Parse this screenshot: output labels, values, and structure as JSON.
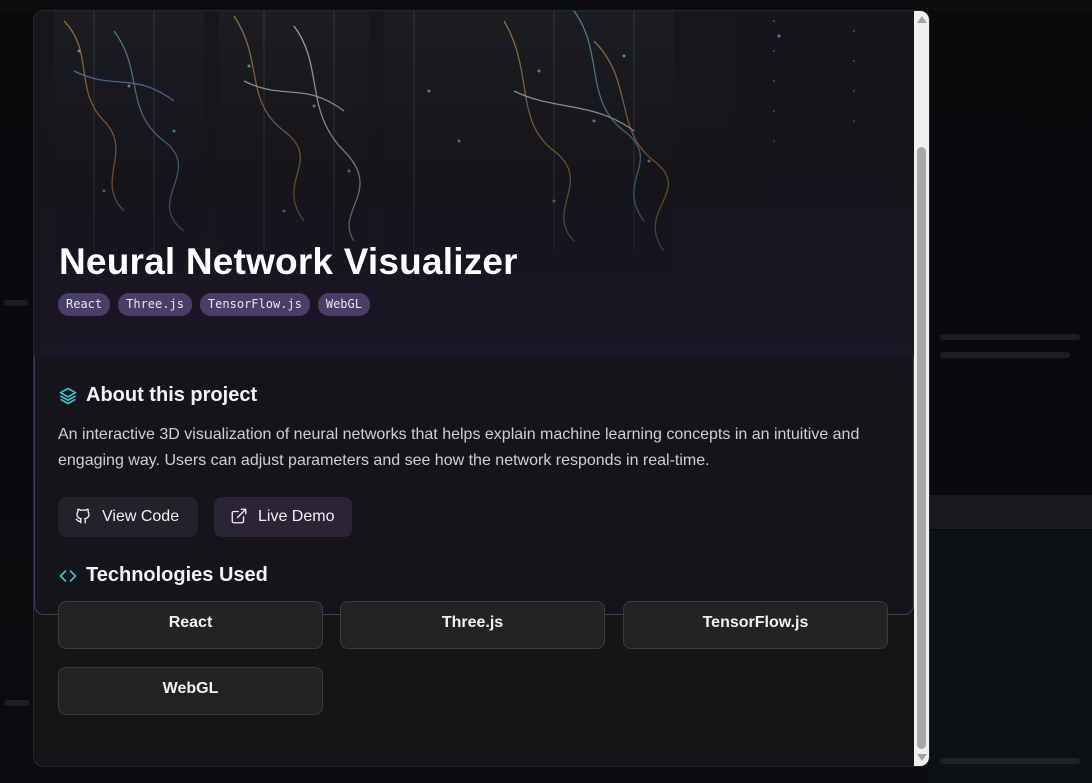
{
  "project": {
    "title": "Neural Network Visualizer",
    "tags": [
      "React",
      "Three.js",
      "TensorFlow.js",
      "WebGL"
    ],
    "about_heading": "About this project",
    "description": "An interactive 3D visualization of neural networks that helps explain machine learning concepts in an intuitive and engaging way. Users can adjust parameters and see how the network responds in real-time.",
    "buttons": {
      "view_code": "View Code",
      "live_demo": "Live Demo"
    },
    "tech_heading": "Technologies Used",
    "technologies": [
      "React",
      "Three.js",
      "TensorFlow.js",
      "WebGL"
    ]
  },
  "icons": {
    "about": "layers-icon",
    "view_code": "github-icon",
    "live_demo": "external-link-icon",
    "tech": "code-icon"
  },
  "colors": {
    "accent_icon": "#2ec4d6",
    "tag_background": "#4a3d67",
    "card_border": "#3a3f6e",
    "modal_background": "#151518"
  }
}
